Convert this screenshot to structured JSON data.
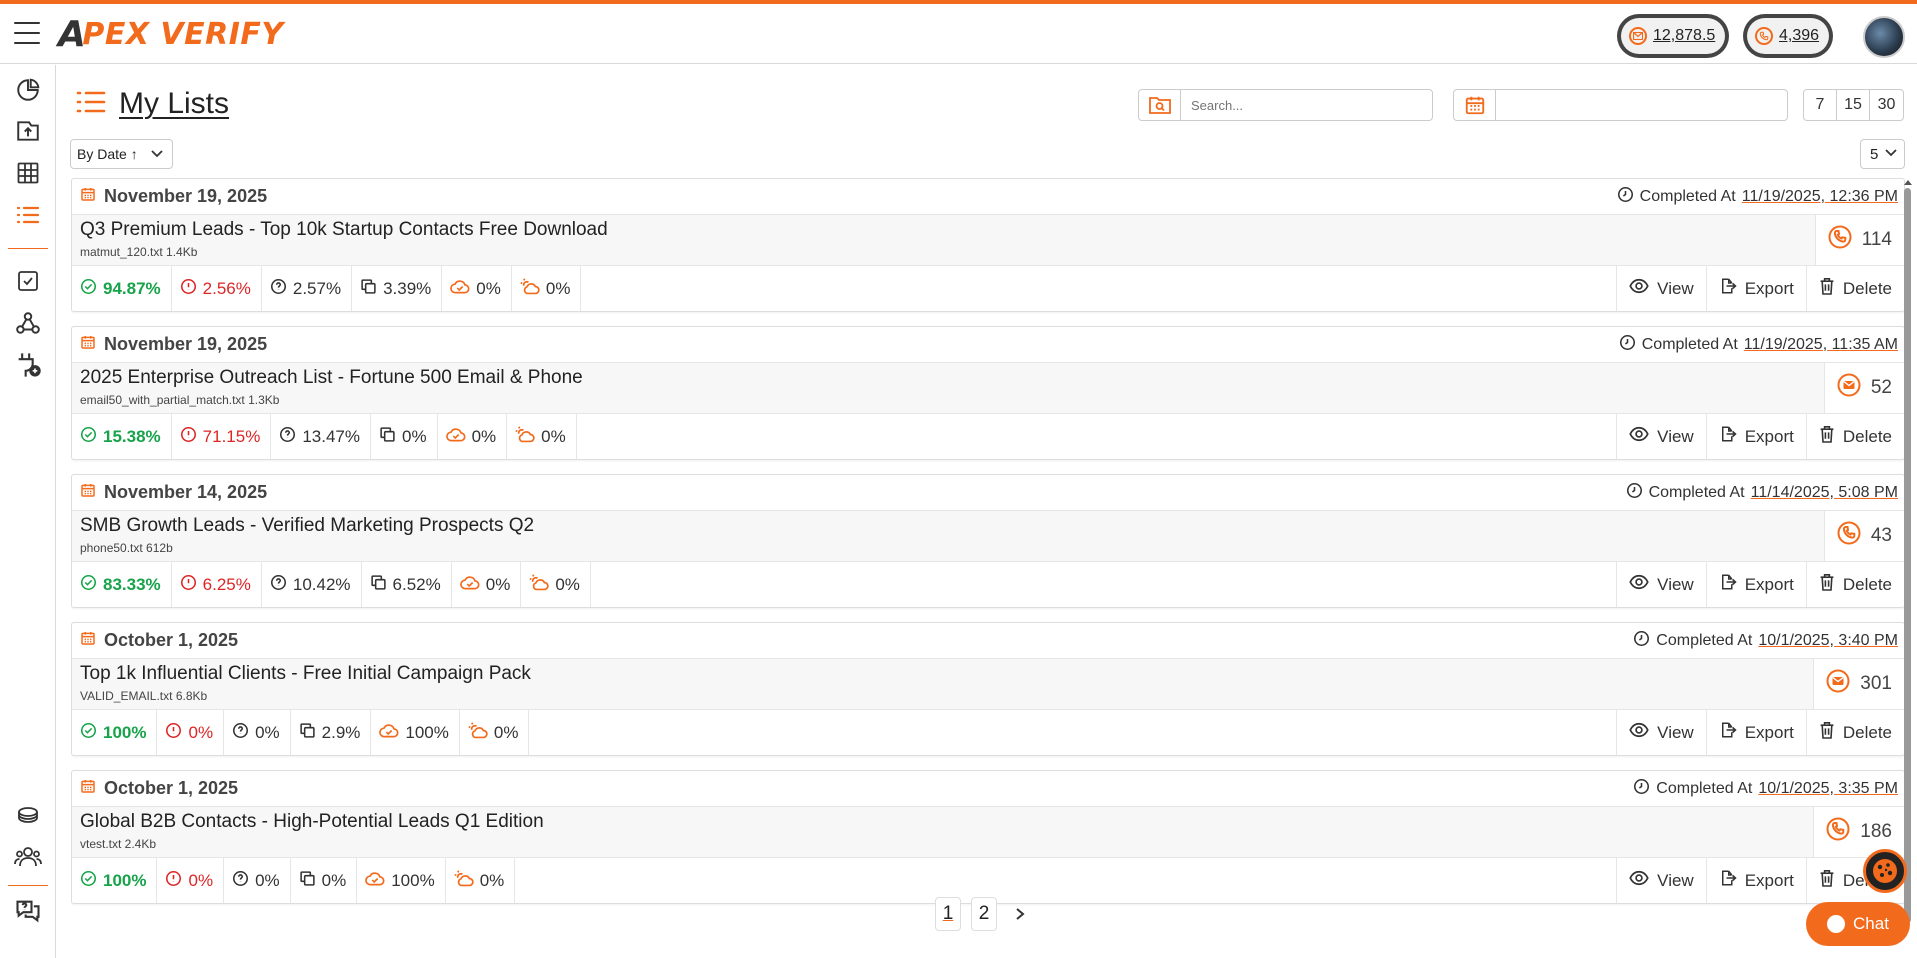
{
  "app": {
    "logo_text": "PEX VERIFY",
    "logo_letter": "A"
  },
  "header": {
    "email_credits": "12,878.5",
    "phone_credits": "4,396"
  },
  "page": {
    "title": "My Lists"
  },
  "search": {
    "placeholder": "Search..."
  },
  "date_range": {
    "value": ""
  },
  "range_buttons": [
    "7",
    "15",
    "30"
  ],
  "sort": {
    "label": "By Date ↑"
  },
  "per_page": {
    "value": "5"
  },
  "labels": {
    "completed_at": "Completed At",
    "view": "View",
    "export": "Export",
    "delete": "Delete"
  },
  "lists": [
    {
      "date": "November 19, 2025",
      "completed": "11/19/2025, 12:36 PM",
      "name": "Q3 Premium Leads - Top 10k Startup Contacts Free Download",
      "file": "matmut_120.txt 1.4Kb",
      "kind": "phone",
      "count": "114",
      "valid": "94.87%",
      "invalid": "2.56%",
      "unknown": "2.57%",
      "duplicate": "3.39%",
      "catch_all": "0%",
      "disposable": "0%"
    },
    {
      "date": "November 19, 2025",
      "completed": "11/19/2025, 11:35 AM",
      "name": "2025 Enterprise Outreach List - Fortune 500 Email & Phone",
      "file": "email50_with_partial_match.txt 1.3Kb",
      "kind": "email",
      "count": "52",
      "valid": "15.38%",
      "invalid": "71.15%",
      "unknown": "13.47%",
      "duplicate": "0%",
      "catch_all": "0%",
      "disposable": "0%"
    },
    {
      "date": "November 14, 2025",
      "completed": "11/14/2025, 5:08 PM",
      "name": "SMB Growth Leads - Verified Marketing Prospects Q2",
      "file": "phone50.txt 612b",
      "kind": "phone",
      "count": "43",
      "valid": "83.33%",
      "invalid": "6.25%",
      "unknown": "10.42%",
      "duplicate": "6.52%",
      "catch_all": "0%",
      "disposable": "0%"
    },
    {
      "date": "October 1, 2025",
      "completed": "10/1/2025, 3:40 PM",
      "name": "Top 1k Influential Clients - Free Initial Campaign Pack",
      "file": "VALID_EMAIL.txt 6.8Kb",
      "kind": "email",
      "count": "301",
      "valid": "100%",
      "invalid": "0%",
      "unknown": "0%",
      "duplicate": "2.9%",
      "catch_all": "100%",
      "disposable": "0%"
    },
    {
      "date": "October 1, 2025",
      "completed": "10/1/2025, 3:35 PM",
      "name": "Global B2B Contacts - High-Potential Leads Q1 Edition",
      "file": "vtest.txt 2.4Kb",
      "kind": "phone",
      "count": "186",
      "valid": "100%",
      "invalid": "0%",
      "unknown": "0%",
      "duplicate": "0%",
      "catch_all": "100%",
      "disposable": "0%"
    }
  ],
  "pagination": {
    "pages": [
      "1",
      "2"
    ],
    "current": "1"
  },
  "chat": {
    "label": "Chat"
  },
  "colors": {
    "accent": "#f26a1b",
    "valid": "#17a34a",
    "invalid": "#dc2626"
  }
}
